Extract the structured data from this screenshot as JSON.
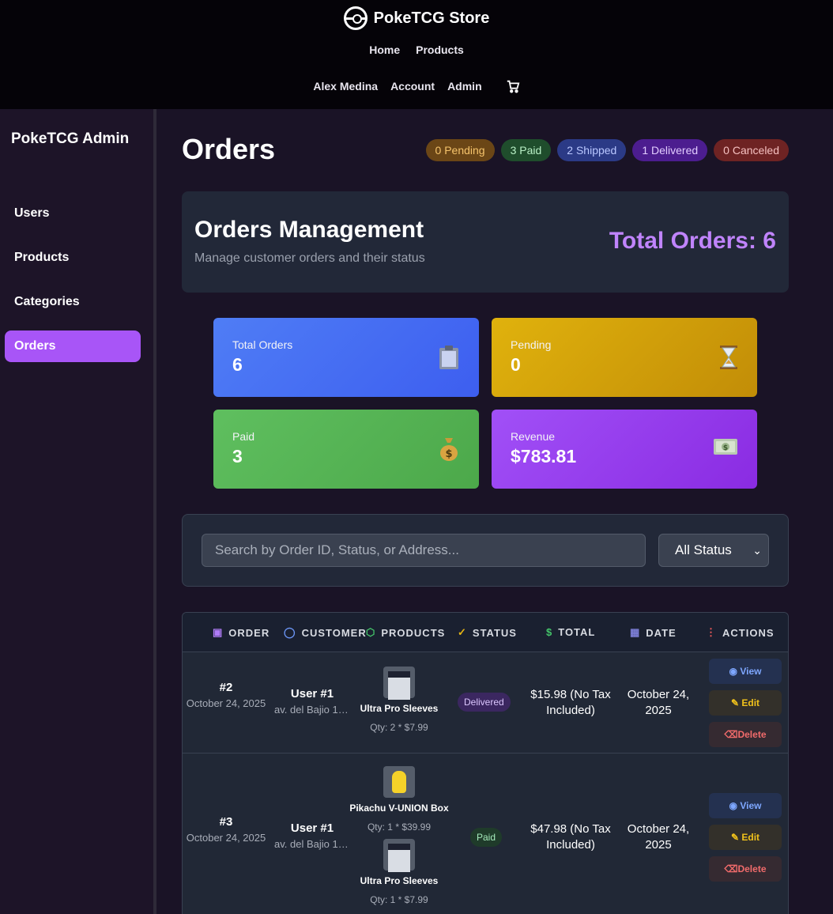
{
  "brand": {
    "name": "PokeTCG Store"
  },
  "nav": {
    "home": "Home",
    "products": "Products",
    "user": "Alex Medina",
    "account": "Account",
    "admin": "Admin"
  },
  "sidebar": {
    "title": "PokeTCG Admin",
    "items": [
      {
        "label": "Users"
      },
      {
        "label": "Products"
      },
      {
        "label": "Categories"
      },
      {
        "label": "Orders"
      }
    ]
  },
  "page": {
    "title": "Orders"
  },
  "badges": [
    {
      "label": "0 Pending",
      "bg": "#6b4616",
      "color": "#f5c36b"
    },
    {
      "label": "3 Paid",
      "bg": "#1f4d2c",
      "color": "#b8efc5"
    },
    {
      "label": "2 Shipped",
      "bg": "#2b3a86",
      "color": "#b9c7ff"
    },
    {
      "label": "1 Delivered",
      "bg": "#4c1d8f",
      "color": "#e2ccff"
    },
    {
      "label": "0 Canceled",
      "bg": "#6e2323",
      "color": "#f5c0c0"
    }
  ],
  "management": {
    "title": "Orders Management",
    "subtitle": "Manage customer orders and their status",
    "total": "Total Orders: 6"
  },
  "cards": {
    "total": {
      "label": "Total Orders",
      "value": "6",
      "icon": "clipboard-icon"
    },
    "pending": {
      "label": "Pending",
      "value": "0",
      "icon": "hourglass-icon"
    },
    "paid": {
      "label": "Paid",
      "value": "3",
      "icon": "money-bag-icon"
    },
    "revenue": {
      "label": "Revenue",
      "value": "$783.81",
      "icon": "dollar-bills-icon"
    }
  },
  "filter": {
    "search_placeholder": "Search by Order ID, Status, or Address...",
    "status_selected": "All Status"
  },
  "table": {
    "headers": {
      "order": "ORDER",
      "customer": "CUSTOMER",
      "products": "PRODUCTS",
      "status": "STATUS",
      "total": "TOTAL",
      "date": "DATE",
      "actions": "ACTIONS"
    },
    "rows": [
      {
        "id": "#2",
        "date_small": "October 24, 2025",
        "customer": "User #1",
        "address": "av. del Bajio 17...",
        "products": [
          {
            "name": "Ultra Pro Sleeves",
            "qty": "Qty: 2 * $7.99"
          }
        ],
        "status": "Delivered",
        "total": "$15.98 (No Tax Included)",
        "date": "October 24, 2025"
      },
      {
        "id": "#3",
        "date_small": "October 24, 2025",
        "customer": "User #1",
        "address": "av. del Bajio 17...",
        "products": [
          {
            "name": "Pikachu V-UNION Box",
            "qty": "Qty: 1 * $39.99"
          },
          {
            "name": "Ultra Pro Sleeves",
            "qty": "Qty: 1 * $7.99"
          }
        ],
        "status": "Paid",
        "total": "$47.98 (No Tax Included)",
        "date": "October 24, 2025"
      }
    ],
    "actions": {
      "view": "View",
      "edit": "Edit",
      "delete": "Delete"
    }
  }
}
